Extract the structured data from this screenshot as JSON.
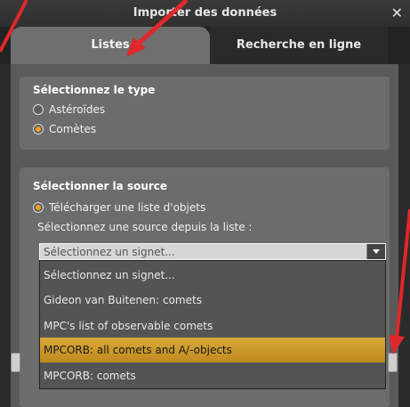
{
  "window": {
    "title": "Importer des données"
  },
  "tabs": [
    {
      "label": "Listes",
      "active": true
    },
    {
      "label": "Recherche en ligne",
      "active": false
    }
  ],
  "type_panel": {
    "title": "Sélectionnez le type",
    "options": [
      {
        "label": "Astéroïdes",
        "checked": false
      },
      {
        "label": "Comètes",
        "checked": true
      }
    ]
  },
  "source_panel": {
    "title": "Sélectionner la source",
    "download_option": {
      "label": "Télécharger une liste d'objets",
      "checked": true
    },
    "list_label": "Sélectionnez une source depuis la liste :",
    "bookmark_combo": {
      "placeholder": "Sélectionnez un signet...",
      "items": [
        {
          "label": "Sélectionnez un signet...",
          "selected": false
        },
        {
          "label": "Gideon van Buitenen: comets",
          "selected": false
        },
        {
          "label": "MPC's list of observable comets",
          "selected": false
        },
        {
          "label": "MPCORB: all comets and A/-objects",
          "selected": true
        },
        {
          "label": "MPCORB: comets",
          "selected": false
        }
      ]
    }
  },
  "colors": {
    "accent": "#f2a020",
    "annotation": "#e0282a",
    "highlight": "#d1a032"
  }
}
